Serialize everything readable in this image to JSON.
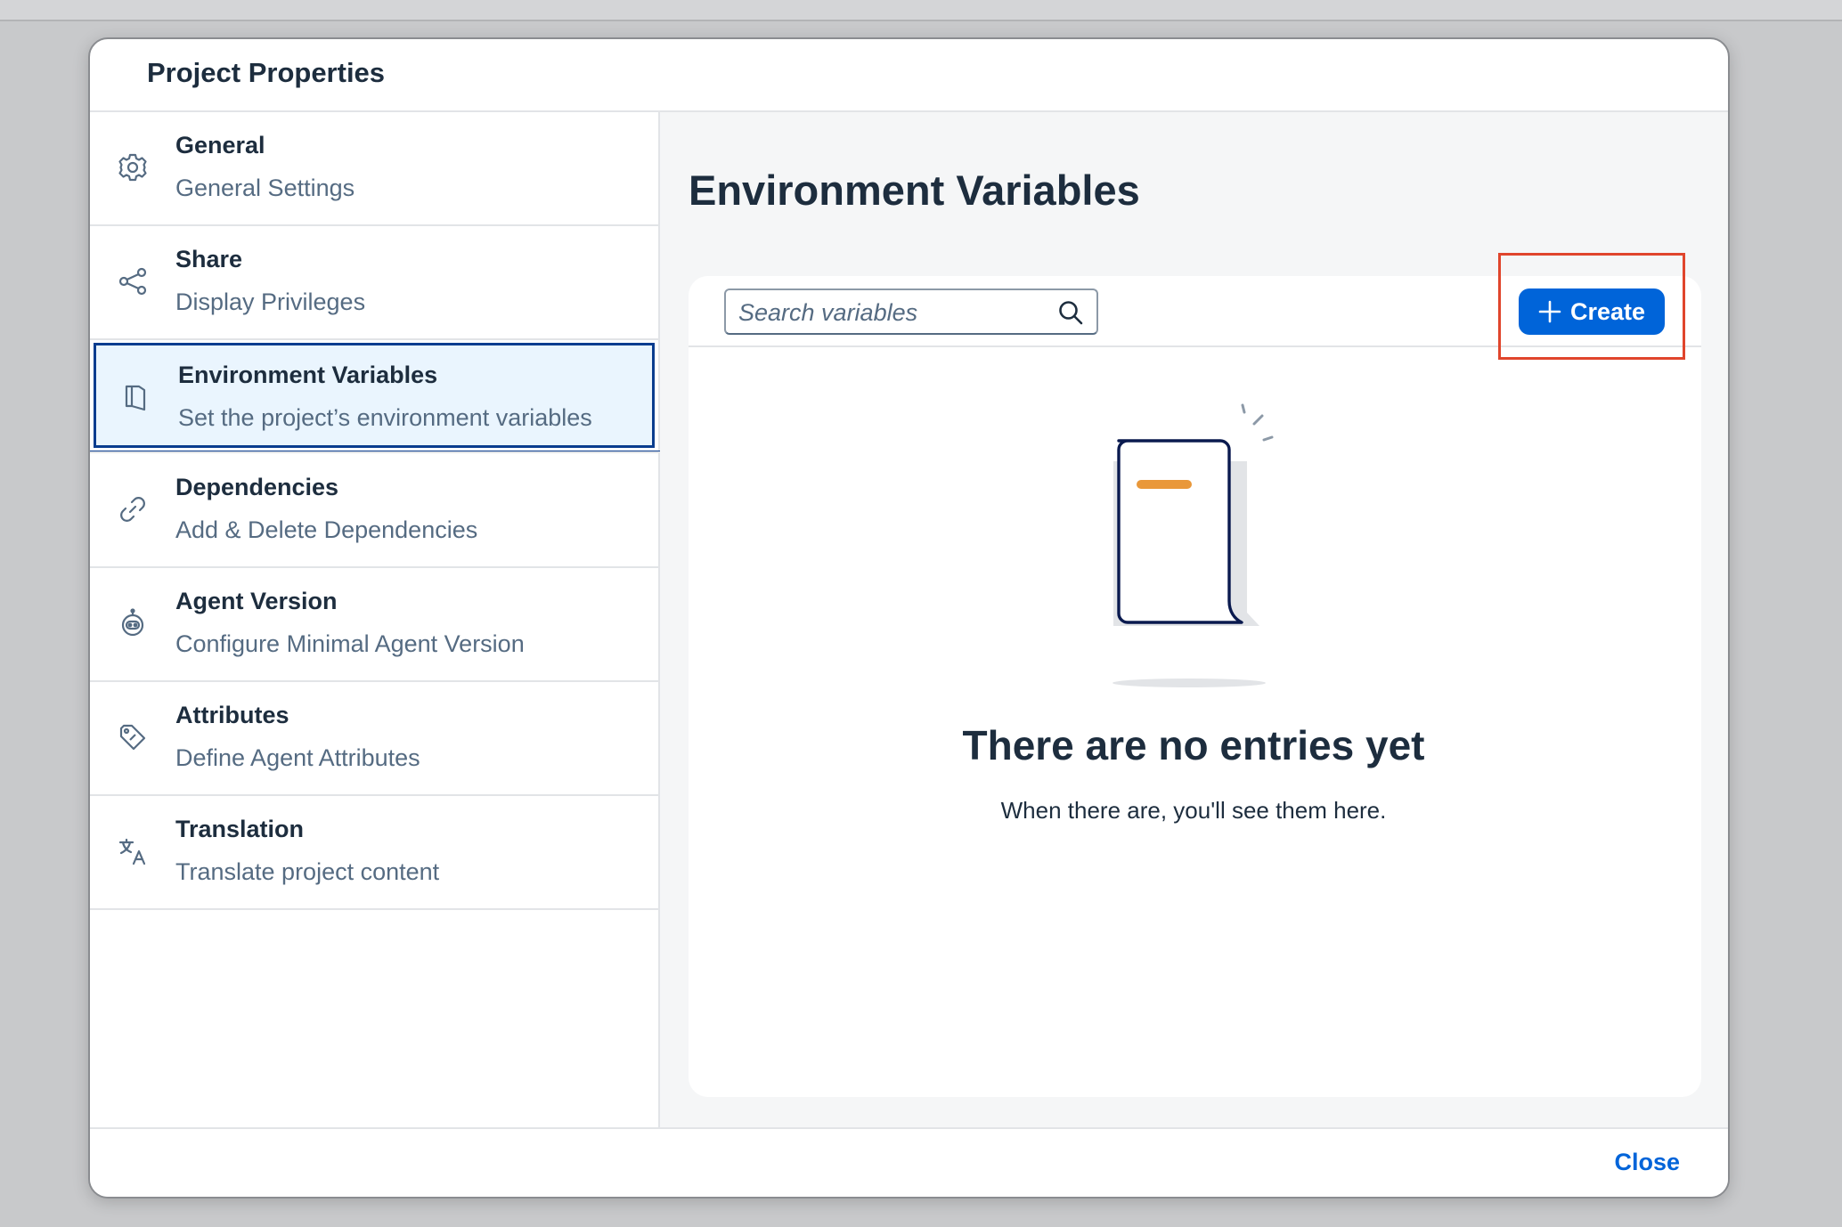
{
  "dialog": {
    "title": "Project Properties",
    "close_label": "Close"
  },
  "sidebar": {
    "items": [
      {
        "title": "General",
        "subtitle": "General Settings",
        "icon": "gear-icon"
      },
      {
        "title": "Share",
        "subtitle": "Display Privileges",
        "icon": "share-icon"
      },
      {
        "title": "Environment Variables",
        "subtitle": "Set the project’s environment variables",
        "icon": "document-icon",
        "selected": true
      },
      {
        "title": "Dependencies",
        "subtitle": "Add & Delete Dependencies",
        "icon": "link-icon"
      },
      {
        "title": "Agent Version",
        "subtitle": "Configure Minimal Agent Version",
        "icon": "robot-icon"
      },
      {
        "title": "Attributes",
        "subtitle": "Define Agent Attributes",
        "icon": "tag-icon"
      },
      {
        "title": "Translation",
        "subtitle": "Translate project content",
        "icon": "translate-icon"
      }
    ]
  },
  "main": {
    "title": "Environment Variables",
    "search": {
      "placeholder": "Search variables",
      "value": ""
    },
    "create_label": "Create",
    "empty_title": "There are no entries yet",
    "empty_subtitle": "When there are, you'll see them here."
  },
  "colors": {
    "accent": "#0064d9",
    "selected_border": "#0a3d8f",
    "selected_bg": "#eaf5fe",
    "highlight": "#e0452c",
    "illustration_accent": "#e9983a"
  }
}
